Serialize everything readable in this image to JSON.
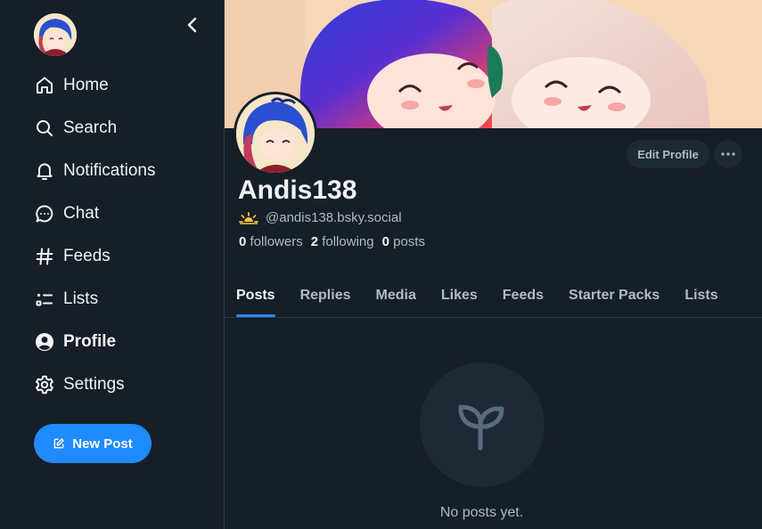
{
  "sidebar": {
    "avatar_icon": "user-avatar",
    "collapse_icon": "chevron-left-icon",
    "items": [
      {
        "label": "Home",
        "icon": "home-icon"
      },
      {
        "label": "Search",
        "icon": "search-icon"
      },
      {
        "label": "Notifications",
        "icon": "bell-icon"
      },
      {
        "label": "Chat",
        "icon": "chat-bubble-icon"
      },
      {
        "label": "Feeds",
        "icon": "hash-icon"
      },
      {
        "label": "Lists",
        "icon": "list-icon"
      },
      {
        "label": "Profile",
        "icon": "user-circle-icon",
        "active": true
      },
      {
        "label": "Settings",
        "icon": "gear-icon"
      }
    ],
    "new_post_label": "New Post"
  },
  "profile": {
    "display_name": "Andis138",
    "handle": "@andis138.bsky.social",
    "followers_count": "0",
    "followers_label": "followers",
    "following_count": "2",
    "following_label": "following",
    "posts_count": "0",
    "posts_label": "posts",
    "edit_label": "Edit Profile"
  },
  "tabs": [
    {
      "label": "Posts",
      "active": true
    },
    {
      "label": "Replies"
    },
    {
      "label": "Media"
    },
    {
      "label": "Likes"
    },
    {
      "label": "Feeds"
    },
    {
      "label": "Starter Packs"
    },
    {
      "label": "Lists"
    }
  ],
  "empty_state": {
    "icon": "sprout-icon",
    "text": "No posts yet."
  },
  "colors": {
    "background": "#161e27",
    "accent": "#208bfe",
    "muted_text": "#aebbc9",
    "surface": "#1e2936"
  }
}
